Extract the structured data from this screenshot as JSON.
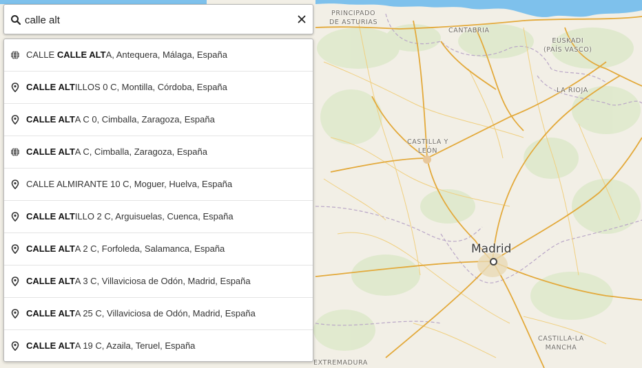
{
  "search": {
    "value": "calle alt",
    "icon": "search-icon",
    "clear_icon": "close-icon"
  },
  "results": [
    {
      "icon": "globe-icon",
      "prefix": "CALLE ",
      "bold": "CALLE ALT",
      "rest": "A, Antequera, Málaga, España"
    },
    {
      "icon": "pin-icon",
      "prefix": "",
      "bold": "CALLE ALT",
      "rest": "ILLOS 0 C, Montilla, Córdoba, España"
    },
    {
      "icon": "pin-icon",
      "prefix": "",
      "bold": "CALLE ALT",
      "rest": "A C 0, Cimballa, Zaragoza, España"
    },
    {
      "icon": "globe-icon",
      "prefix": "",
      "bold": "CALLE ALT",
      "rest": "A C, Cimballa, Zaragoza, España"
    },
    {
      "icon": "pin-icon",
      "prefix": "CALLE ALMIRANTE 10 C, Moguer, Huelva, España",
      "bold": "",
      "rest": ""
    },
    {
      "icon": "pin-icon",
      "prefix": "",
      "bold": "CALLE ALT",
      "rest": "ILLO 2 C, Arguisuelas, Cuenca, España"
    },
    {
      "icon": "pin-icon",
      "prefix": "",
      "bold": "CALLE ALT",
      "rest": "A 2 C, Forfoleda, Salamanca, España"
    },
    {
      "icon": "pin-icon",
      "prefix": "",
      "bold": "CALLE ALT",
      "rest": "A 3 C, Villaviciosa de Odón, Madrid, España"
    },
    {
      "icon": "pin-icon",
      "prefix": "",
      "bold": "CALLE ALT",
      "rest": "A 25 C, Villaviciosa de Odón, Madrid, España"
    },
    {
      "icon": "pin-icon",
      "prefix": "",
      "bold": "CALLE ALT",
      "rest": "A 19 C, Azaila, Teruel, España"
    }
  ],
  "map": {
    "labels": {
      "asturias_1": "PRINCIPADO",
      "asturias_2": "DE ASTURIAS",
      "cantabria": "CANTABRIA",
      "euskadi_1": "EUSKADI",
      "euskadi_2": "(PAÍS VASCO)",
      "rioja": "LA RIOJA",
      "cyl_1": "CASTILLA Y",
      "cyl_2": "LEÓN",
      "madrid": "Madrid",
      "clm_1": "CASTILLA-LA",
      "clm_2": "MANCHA",
      "extremadura": "EXTREMADURA"
    },
    "colors": {
      "land": "#f2efe6",
      "sea": "#7ec1ec",
      "road": "#e3a93a",
      "minor_road": "#f2d58a",
      "border": "#b7a3c4",
      "green": "#d9e6c6"
    }
  }
}
